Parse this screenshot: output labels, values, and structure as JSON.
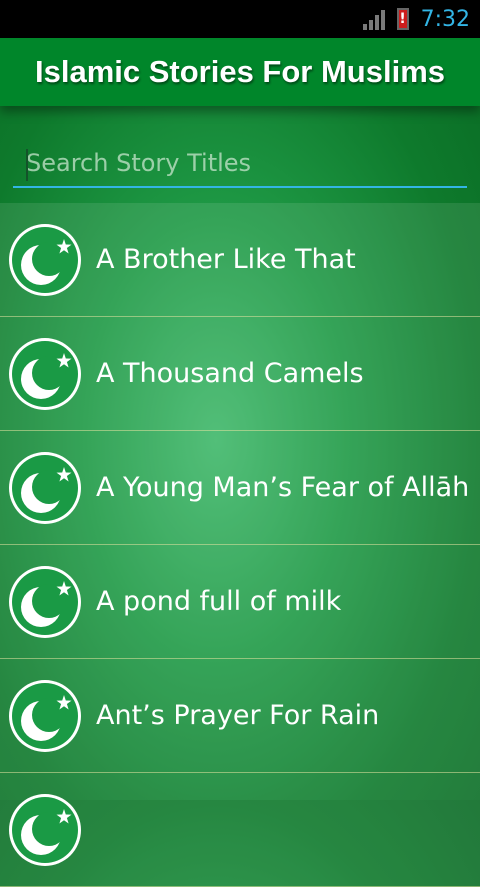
{
  "status_bar": {
    "time": "7:32",
    "battery_alert": "!"
  },
  "app_bar": {
    "title": "Islamic Stories For Muslims"
  },
  "search": {
    "placeholder": "Search Story Titles",
    "value": ""
  },
  "stories": [
    {
      "title": "A Brother Like That"
    },
    {
      "title": "A Thousand Camels"
    },
    {
      "title": "A Young Man’s Fear of Allāh"
    },
    {
      "title": "A pond full of milk"
    },
    {
      "title": "Ant’s Prayer For Rain"
    },
    {
      "title": ""
    }
  ],
  "icon": "crescent-star-icon",
  "colors": {
    "app_bar": "#00862a",
    "accent": "#33b5e5",
    "icon_green": "#1a9a45"
  }
}
